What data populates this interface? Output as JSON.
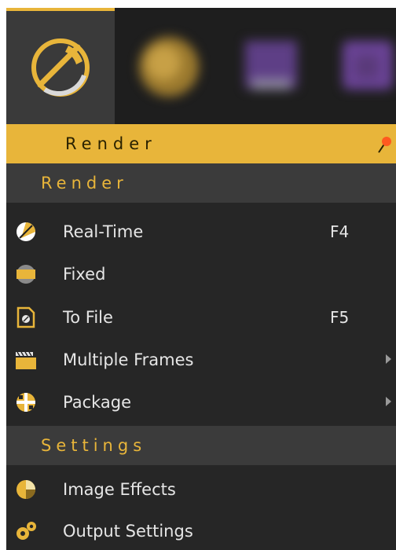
{
  "header": {
    "title": "Render"
  },
  "sections": {
    "render": "Render",
    "settings": "Settings"
  },
  "menu": {
    "realtime": {
      "label": "Real-Time",
      "shortcut": "F4",
      "icon": "realtime-icon"
    },
    "fixed": {
      "label": "Fixed",
      "icon": "fixed-icon"
    },
    "tofile": {
      "label": "To File",
      "shortcut": "F5",
      "icon": "file-icon"
    },
    "multiple": {
      "label": "Multiple Frames",
      "icon": "clapper-icon",
      "submenu": true
    },
    "package": {
      "label": "Package",
      "icon": "package-icon",
      "submenu": true
    },
    "effects": {
      "label": "Image Effects",
      "icon": "image-effects-icon"
    },
    "output": {
      "label": "Output Settings",
      "icon": "gears-icon"
    }
  },
  "colors": {
    "accent": "#e8b53a",
    "text": "#e6e6e6",
    "panel": "#262626",
    "section_bg": "#3b3b3b"
  }
}
